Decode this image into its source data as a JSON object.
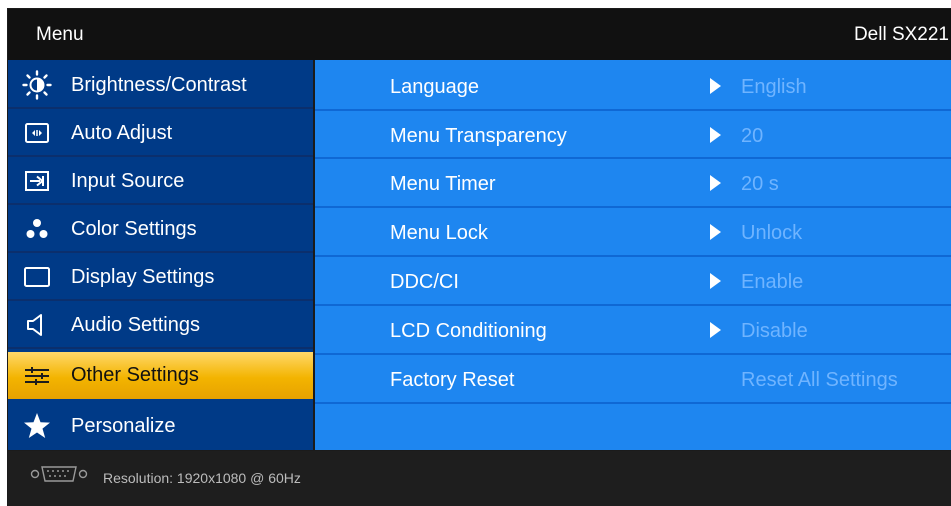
{
  "header": {
    "title": "Menu",
    "model": "Dell SX221"
  },
  "nav": {
    "items": [
      {
        "label": "Brightness/Contrast",
        "icon": "brightness-icon"
      },
      {
        "label": "Auto Adjust",
        "icon": "auto-adjust-icon"
      },
      {
        "label": "Input Source",
        "icon": "input-source-icon"
      },
      {
        "label": "Color Settings",
        "icon": "color-settings-icon"
      },
      {
        "label": "Display Settings",
        "icon": "display-icon"
      },
      {
        "label": "Audio Settings",
        "icon": "speaker-icon"
      },
      {
        "label": "Other Settings",
        "icon": "sliders-icon",
        "active": true
      },
      {
        "label": "Personalize",
        "icon": "star-icon"
      }
    ]
  },
  "settings": [
    {
      "name": "Language",
      "value": "English"
    },
    {
      "name": "Menu Transparency",
      "value": "20"
    },
    {
      "name": "Menu Timer",
      "value": "20 s"
    },
    {
      "name": "Menu Lock",
      "value": "Unlock"
    },
    {
      "name": "DDC/CI",
      "value": "Enable"
    },
    {
      "name": "LCD Conditioning",
      "value": "Disable"
    },
    {
      "name": "Factory Reset",
      "value": "Reset All Settings"
    }
  ],
  "footer": {
    "resolution": "Resolution: 1920x1080 @ 60Hz",
    "icon": "vga-connector-icon"
  },
  "colors": {
    "nav_bg": "#003a87",
    "content_bg": "#1e86f0",
    "active_item": "#f3b400",
    "value_text": "#6fb4ff"
  }
}
